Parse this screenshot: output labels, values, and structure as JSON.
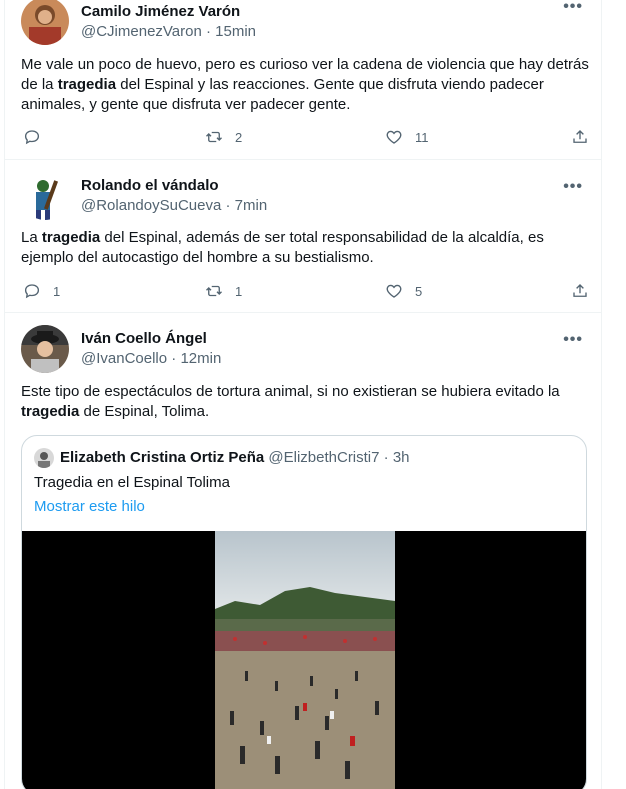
{
  "tweets": [
    {
      "name": "Camilo Jiménez Varón",
      "handle": "@CJimenezVaron",
      "sep": "·",
      "time": "15min",
      "more": "•••",
      "text_parts": [
        "Me vale un poco de huevo, pero es curioso ver la cadena de violencia que hay detrás de la ",
        "tragedia",
        " del Espinal y las reacciones. Gente que disfruta viendo padecer animales, y gente que disfruta ver padecer gente."
      ],
      "replies": "",
      "retweets": "2",
      "likes": "11"
    },
    {
      "name": "Rolando el vándalo",
      "handle": "@RolandoySuCueva",
      "sep": "·",
      "time": "7min",
      "more": "•••",
      "text_parts": [
        "La ",
        "tragedia",
        " del Espinal, además de ser total responsabilidad de la alcaldía, es ejemplo del autocastigo del hombre a su bestialismo."
      ],
      "replies": "1",
      "retweets": "1",
      "likes": "5"
    },
    {
      "name": "Iván Coello Ángel",
      "handle": "@IvanCoello",
      "sep": "·",
      "time": "12min",
      "more": "•••",
      "text_parts": [
        "Este tipo de espectáculos de tortura animal, si no existieran se hubiera evitado la ",
        "tragedia",
        " de Espinal, Tolima."
      ]
    }
  ],
  "quote": {
    "name": "Elizabeth Cristina Ortiz Peña",
    "handle": "@ElizbethCristi7",
    "sep": "·",
    "time": "3h",
    "text": "Tragedia en el Espinal Tolima",
    "link": "Mostrar este hilo"
  },
  "icons": [
    "reply-icon",
    "retweet-icon",
    "like-icon",
    "share-icon",
    "more-icon"
  ],
  "colors": {
    "link": "#1d9bf0",
    "secondary": "#536471",
    "border": "#eff3f4"
  }
}
